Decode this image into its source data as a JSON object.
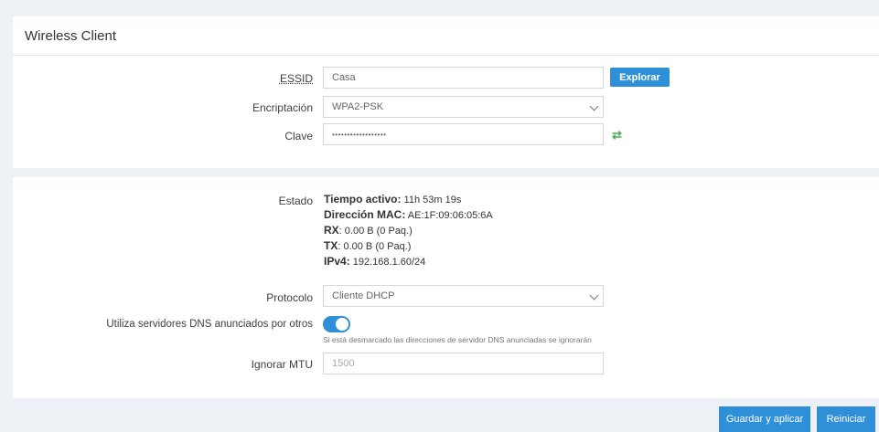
{
  "wireless": {
    "title": "Wireless Client",
    "essid_label": "ESSID",
    "essid_value": "Casa",
    "explore_label": "Explorar",
    "encryption_label": "Encriptación",
    "encryption_value": "WPA2-PSK",
    "key_label": "Clave",
    "key_value": "••••••••••••••••••"
  },
  "status": {
    "label": "Estado",
    "uptime_label": "Tiempo activo:",
    "uptime_value": "11h 53m 19s",
    "mac_label": "Dirección MAC:",
    "mac_value": "AE:1F:09:06:05:6A",
    "rx_label": "RX",
    "rx_value": ": 0.00 B (0 Paq.)",
    "tx_label": "TX",
    "tx_value": ": 0.00 B (0 Paq.)",
    "ipv4_label": "IPv4:",
    "ipv4_value": "192.168.1.60/24"
  },
  "network": {
    "protocol_label": "Protocolo",
    "protocol_value": "Cliente DHCP",
    "dns_label": "Utiliza servidores DNS anunciados por otros",
    "dns_enabled": true,
    "dns_hint": "Si está desmarcado las direcciones de servidor DNS anunciadas se ignorarán",
    "mtu_label": "Ignorar MTU",
    "mtu_placeholder": "1500"
  },
  "actions": {
    "save_apply": "Guardar y aplicar",
    "restart": "Reiniciar"
  },
  "colors": {
    "accent": "#2f90d7",
    "refresh_icon": "#4caf50"
  }
}
